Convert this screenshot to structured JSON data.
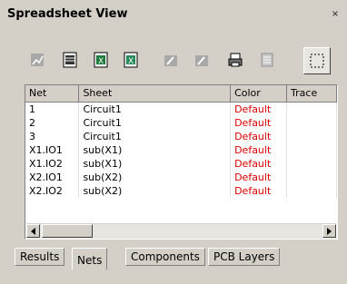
{
  "window": {
    "title": "Spreadsheet View",
    "close_glyph": "×"
  },
  "toolbar": {
    "buttons": [
      {
        "icon": "chart-disabled-icon"
      },
      {
        "icon": "sheet-icon"
      },
      {
        "icon": "excel-export-icon"
      },
      {
        "icon": "excel-import-icon"
      },
      {
        "icon": "sign-disabled-icon"
      },
      {
        "icon": "sign-disabled-icon-2"
      },
      {
        "icon": "print-icon"
      },
      {
        "icon": "properties-disabled-icon"
      },
      {
        "icon": "select-region-icon"
      }
    ]
  },
  "grid": {
    "columns": [
      "Net",
      "Sheet",
      "Color",
      "Trace"
    ],
    "rows": [
      {
        "net": "1",
        "sheet": "Circuit1",
        "color": "Default"
      },
      {
        "net": "2",
        "sheet": "Circuit1",
        "color": "Default"
      },
      {
        "net": "3",
        "sheet": "Circuit1",
        "color": "Default"
      },
      {
        "net": "X1.IO1",
        "sheet": "sub(X1)",
        "color": "Default"
      },
      {
        "net": "X1.IO2",
        "sheet": "sub(X1)",
        "color": "Default"
      },
      {
        "net": "X2.IO1",
        "sheet": "sub(X2)",
        "color": "Default"
      },
      {
        "net": "X2.IO2",
        "sheet": "sub(X2)",
        "color": "Default"
      }
    ],
    "default_color": "#e00000"
  },
  "tabs": [
    {
      "label": "Results",
      "active": false
    },
    {
      "label": "Nets",
      "active": true
    },
    {
      "label": "Components",
      "active": false
    },
    {
      "label": "PCB Layers",
      "active": false
    }
  ]
}
